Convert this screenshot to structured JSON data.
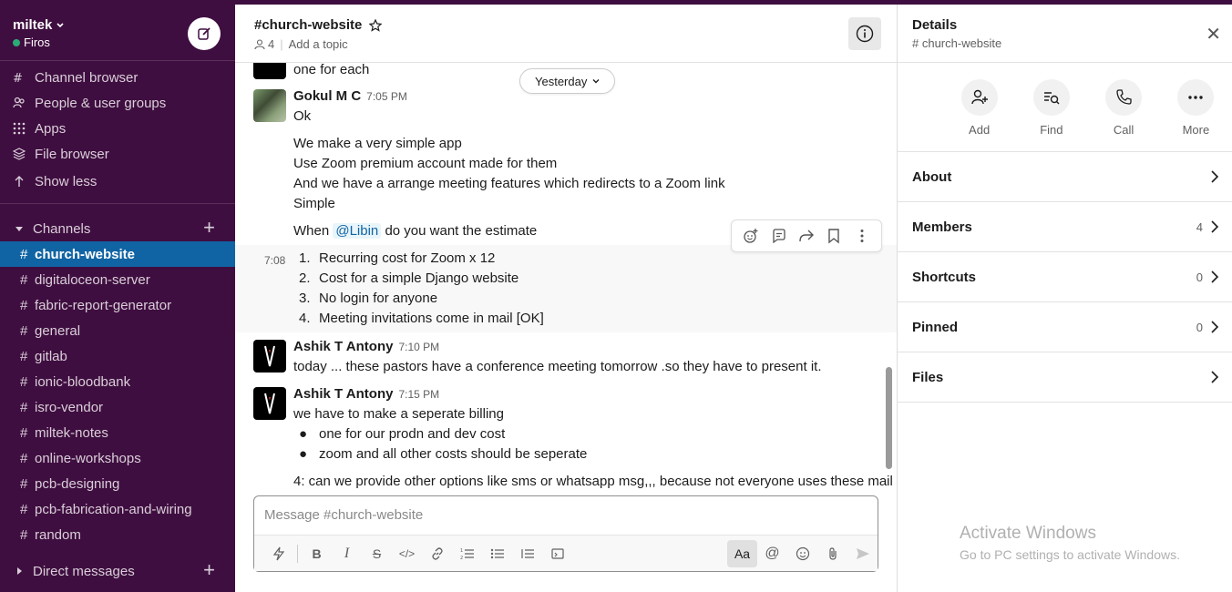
{
  "workspace": {
    "name": "miltek",
    "user": "Firos"
  },
  "sidebar": {
    "nav": [
      {
        "label": "Channel browser",
        "icon": "channel-browser-icon"
      },
      {
        "label": "People & user groups",
        "icon": "people-icon"
      },
      {
        "label": "Apps",
        "icon": "apps-grid-icon"
      },
      {
        "label": "File browser",
        "icon": "files-icon"
      },
      {
        "label": "Show less",
        "icon": "arrow-up-icon"
      }
    ],
    "channels_label": "Channels",
    "channels": [
      "church-website",
      "digitaloceon-server",
      "fabric-report-generator",
      "general",
      "gitlab",
      "ionic-bloodbank",
      "isro-vendor",
      "miltek-notes",
      "online-workshops",
      "pcb-designing",
      "pcb-fabrication-and-wiring",
      "random"
    ],
    "active_channel": "church-website",
    "dm_label": "Direct messages"
  },
  "channel": {
    "title": "#church-website",
    "members_count": "4",
    "topic_placeholder": "Add a topic"
  },
  "date_divider": "Yesterday",
  "messages": {
    "prev_line": "one for each",
    "gokul": {
      "sender": "Gokul M C",
      "time": "7:05 PM",
      "lines": [
        "Ok",
        "We make a very simple app",
        "Use Zoom premium account made for them",
        "And we have a arrange meeting features which redirects to a Zoom link",
        "Simple"
      ],
      "when_pre": "When",
      "mention": "@Libin",
      "when_post": "do you want the estimate"
    },
    "followup": {
      "time": "7:08",
      "items": [
        "Recurring cost for Zoom x 12",
        "Cost for a simple Django website",
        "No login for anyone",
        "Meeting invitations come in mail [OK]"
      ]
    },
    "ashik1": {
      "sender": "Ashik T Antony",
      "time": "7:10 PM",
      "text": "today ... these pastors have a conference meeting tomorrow .so they have to present it."
    },
    "ashik2": {
      "sender": "Ashik T Antony",
      "time": "7:15 PM",
      "text": "we have to make a seperate billing",
      "bullets": [
        "one for our prodn and dev cost",
        "zoom and all other costs should be seperate"
      ],
      "cut_line": "4: can we provide other options like sms or whatsapp msg,,, because not everyone uses these mail"
    }
  },
  "composer": {
    "placeholder": "Message #church-website",
    "aa_label": "Aa"
  },
  "details": {
    "title": "Details",
    "subtitle": "# church-website",
    "actions": [
      {
        "label": "Add",
        "icon": "add-person-icon"
      },
      {
        "label": "Find",
        "icon": "find-icon"
      },
      {
        "label": "Call",
        "icon": "phone-icon"
      },
      {
        "label": "More",
        "icon": "more-icon"
      }
    ],
    "rows": [
      {
        "label": "About",
        "count": ""
      },
      {
        "label": "Members",
        "count": "4"
      },
      {
        "label": "Shortcuts",
        "count": "0"
      },
      {
        "label": "Pinned",
        "count": "0"
      },
      {
        "label": "Files",
        "count": ""
      }
    ]
  },
  "watermark": {
    "line1": "Activate Windows",
    "line2": "Go to PC settings to activate Windows."
  },
  "colors": {
    "sidebar": "#3f0e40",
    "active": "#1164a3",
    "mention_bg": "#e8f5fa",
    "mention_fg": "#1264a3",
    "presence": "#2bac76"
  }
}
